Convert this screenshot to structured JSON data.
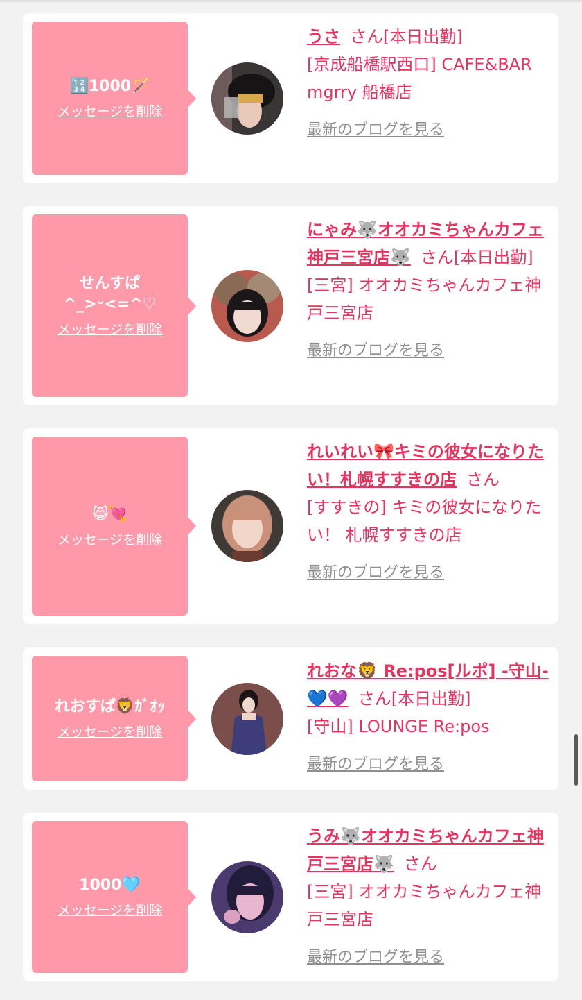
{
  "delete_label": "メッセージを削除",
  "blog_label": "最新のブログを見る",
  "san_suffix": "さん",
  "cards": [
    {
      "message": "🔢1000🪄",
      "name": "うさ",
      "status": "[本日出勤]",
      "location": "[京成船橋駅西口] CAFE&BAR mgrry 船橋店"
    },
    {
      "message": "せんすぱ^_>ᵕ<=^♡",
      "name": "にゃみ🐺オオカミちゃんカフェ神戸三宮店🐺",
      "status": "[本日出勤]",
      "location": "[三宮] オオカミちゃんカフェ神戸三宮店"
    },
    {
      "message": "😸💘",
      "name": "れいれい🎀キミの彼女になりたい！札幌すすきの店",
      "status": "",
      "location": "[すすきの] キミの彼女になりたい！ 札幌すすきの店"
    },
    {
      "message": "れおすぱ🦁ｶﾞｵｯ",
      "name": "れおな🦁 Re:pos[ルポ] -守山-💙💜",
      "status": "[本日出勤]",
      "location": "[守山] LOUNGE Re:pos"
    },
    {
      "message": "1000🩵",
      "name": "うみ🐺オオカミちゃんカフェ神戸三宮店🐺",
      "status": "",
      "location": "[三宮] オオカミちゃんカフェ神戸三宮店"
    }
  ],
  "colors": {
    "accent": "#e8335f",
    "bubble": "#fd99a8",
    "link_gray": "#8f8f8f",
    "background": "#f2f2f2"
  }
}
